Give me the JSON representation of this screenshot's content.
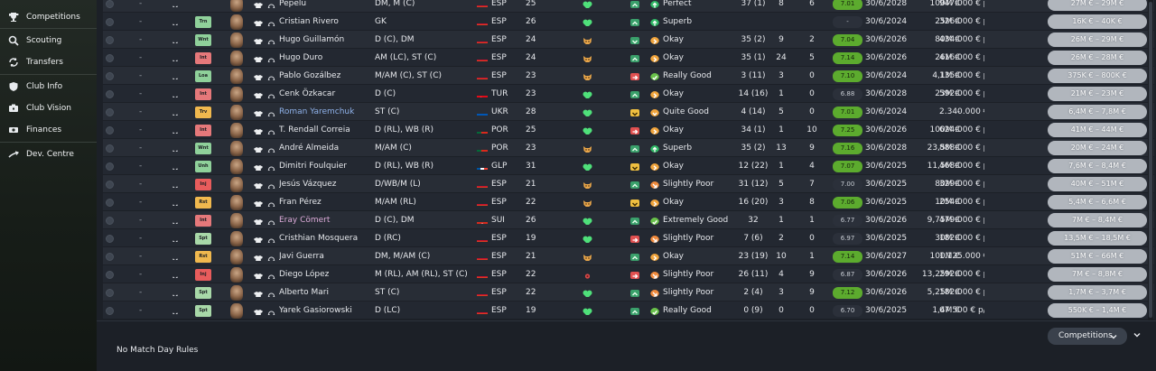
{
  "sidebar": {
    "items": [
      {
        "label": "Competitions",
        "icon": "trophy-icon"
      },
      {
        "label": "Scouting",
        "icon": "search-icon"
      },
      {
        "label": "Transfers",
        "icon": "transfer-arrows-icon"
      },
      {
        "label": "Club Info",
        "icon": "shield-icon"
      },
      {
        "label": "Club Vision",
        "icon": "club-vision-icon"
      },
      {
        "label": "Finances",
        "icon": "finances-icon"
      },
      {
        "label": "Dev. Centre",
        "icon": "development-icon"
      }
    ]
  },
  "colors": {
    "rating_green": "#5cab2e",
    "heart_green": "#4fe07a",
    "status_green": "#2fb765",
    "status_orange": "#f0a43c",
    "morale_green": "#3aa06b",
    "morale_red": "#e05050",
    "morale_yellow": "#f0c040"
  },
  "players": [
    {
      "name": "Pepelu",
      "role": "",
      "pos": "DM, M (C)",
      "flag": "ESP",
      "nat": "ESP",
      "age": "25",
      "heart": "green",
      "morale": "up",
      "status": "Perfect",
      "status_icon": "up",
      "apps": "37 (1)",
      "gls": "8",
      "ast": "6",
      "rating": "7.01",
      "rating_good": true,
      "expires": "30/6/2028",
      "value": "100M €",
      "wage": "947.000 € p/a",
      "range": "27M € – 29M €",
      "name_style": ""
    },
    {
      "name": "Cristian Rivero",
      "role": "Trn",
      "pos": "GK",
      "flag": "ESP",
      "nat": "ESP",
      "age": "26",
      "heart": "green",
      "morale": "up",
      "status": "Superb",
      "status_icon": "up",
      "apps": "",
      "gls": "",
      "ast": "",
      "rating": "-",
      "rating_good": false,
      "expires": "30/6/2024",
      "value": "25M €",
      "wage": "326.000 € p/a",
      "range": "16K € – 40K €",
      "name_style": ""
    },
    {
      "name": "Hugo Guillamón",
      "role": "Wnt",
      "pos": "D (C), DM",
      "flag": "ESP",
      "nat": "ESP",
      "age": "24",
      "heart": "fox",
      "morale": "down",
      "status": "Okay",
      "status_icon": "right",
      "apps": "35 (2)",
      "gls": "9",
      "ast": "2",
      "rating": "7.04",
      "rating_good": true,
      "expires": "30/6/2026",
      "value": "80M €",
      "wage": "434.000 € p/a",
      "range": "26M € – 29M €",
      "name_style": ""
    },
    {
      "name": "Hugo Duro",
      "role": "Int",
      "pos": "AM (LC), ST (C)",
      "flag": "ESP",
      "nat": "ESP",
      "age": "24",
      "heart": "fox",
      "morale": "up",
      "status": "Okay",
      "status_icon": "right",
      "apps": "35 (1)",
      "gls": "24",
      "ast": "5",
      "rating": "7.14",
      "rating_good": true,
      "expires": "30/6/2026",
      "value": "26M €",
      "wage": "416.000 € p/a",
      "range": "26M € – 28M €",
      "name_style": ""
    },
    {
      "name": "Pablo Gozálbez",
      "role": "Loa",
      "pos": "M/AM (C), ST (C)",
      "flag": "ESP",
      "nat": "ESP",
      "age": "23",
      "heart": "fox",
      "morale": "red",
      "status": "Really Good",
      "status_icon": "check",
      "apps": "3 (11)",
      "gls": "3",
      "ast": "0",
      "rating": "7.10",
      "rating_good": true,
      "expires": "30/6/2024",
      "value": "4,1M €",
      "wage": "135.000 € p/a",
      "range": "375K € – 800K €",
      "name_style": ""
    },
    {
      "name": "Cenk Özkacar",
      "role": "Int",
      "pos": "D (C)",
      "flag": "TUR",
      "nat": "TUR",
      "age": "23",
      "heart": "green",
      "morale": "up",
      "status": "Okay",
      "status_icon": "right",
      "apps": "14 (16)",
      "gls": "1",
      "ast": "0",
      "rating": "6.88",
      "rating_good": false,
      "expires": "30/6/2028",
      "value": "23M €",
      "wage": "592.000 € p/a",
      "range": "21M € – 23M €",
      "name_style": ""
    },
    {
      "name": "Roman Yaremchuk",
      "role": "Trv",
      "pos": "ST (C)",
      "flag": "UKR",
      "nat": "UKR",
      "age": "28",
      "heart": "green",
      "morale": "yellow",
      "status": "Quite Good",
      "status_icon": "down",
      "apps": "4 (14)",
      "gls": "5",
      "ast": "0",
      "rating": "7.01",
      "rating_good": true,
      "expires": "30/6/2024",
      "value": "-",
      "wage": "2.340.000 € p/a",
      "range": "6,4M € – 7,8M €",
      "name_style": "hl"
    },
    {
      "name": "T. Rendall Correia",
      "role": "Int",
      "pos": "D (RL), WB (R)",
      "flag": "POR",
      "nat": "POR",
      "age": "25",
      "heart": "green",
      "morale": "red",
      "status": "Okay",
      "status_icon": "right",
      "apps": "34 (1)",
      "gls": "1",
      "ast": "10",
      "rating": "7.25",
      "rating_good": true,
      "expires": "30/6/2026",
      "value": "100M €",
      "wage": "624.000 € p/a",
      "range": "41M € – 44M €",
      "name_style": ""
    },
    {
      "name": "André Almeida",
      "role": "Wnt",
      "pos": "M/AM (C)",
      "flag": "POR",
      "nat": "POR",
      "age": "23",
      "heart": "fox",
      "morale": "up",
      "status": "Superb",
      "status_icon": "up",
      "apps": "35 (2)",
      "gls": "13",
      "ast": "9",
      "rating": "7.16",
      "rating_good": true,
      "expires": "30/6/2028",
      "value": "23,5M €",
      "wage": "888.000 € p/a",
      "range": "20M € – 24M €",
      "name_style": ""
    },
    {
      "name": "Dimitri Foulquier",
      "role": "Unh",
      "pos": "D (RL), WB (R)",
      "flag": "GLP",
      "nat": "GLP",
      "age": "31",
      "heart": "green",
      "morale": "yellow",
      "status": "Okay",
      "status_icon": "right",
      "apps": "12 (22)",
      "gls": "1",
      "ast": "4",
      "rating": "7.07",
      "rating_good": true,
      "expires": "30/6/2025",
      "value": "11,5M €",
      "wage": "468.000 € p/a",
      "range": "7,6M € – 8,4M €",
      "name_style": ""
    },
    {
      "name": "Jesús Vázquez",
      "role": "Inj",
      "pos": "D/WB/M (L)",
      "flag": "ESP",
      "nat": "ESP",
      "age": "21",
      "heart": "fox",
      "morale": "up",
      "status": "Slightly Poor",
      "status_icon": "downright",
      "apps": "31 (12)",
      "gls": "5",
      "ast": "7",
      "rating": "7.00",
      "rating_good": false,
      "expires": "30/6/2025",
      "value": "80M €",
      "wage": "329.000 € p/a",
      "range": "40M € – 51M €",
      "name_style": ""
    },
    {
      "name": "Fran Pérez",
      "role": "Rst",
      "pos": "M/AM (RL)",
      "flag": "ESP",
      "nat": "ESP",
      "age": "22",
      "heart": "fox",
      "morale": "yellow",
      "status": "Okay",
      "status_icon": "right",
      "apps": "16 (20)",
      "gls": "3",
      "ast": "8",
      "rating": "7.06",
      "rating_good": true,
      "expires": "30/6/2025",
      "value": "10M €",
      "wage": "254.000 € p/a",
      "range": "5,4M € – 6,6M €",
      "name_style": ""
    },
    {
      "name": "Eray Cömert",
      "role": "Int",
      "pos": "D (C), DM",
      "flag": "SUI",
      "nat": "SUI",
      "age": "26",
      "heart": "green",
      "morale": "up",
      "status": "Extremely Good",
      "status_icon": "check",
      "apps": "32",
      "gls": "1",
      "ast": "1",
      "rating": "6.77",
      "rating_good": false,
      "expires": "30/6/2026",
      "value": "9,75M €",
      "wage": "479.000 € p/a",
      "range": "7M € – 8,4M €",
      "name_style": "pink"
    },
    {
      "name": "Cristhian Mosquera",
      "role": "Spt",
      "pos": "D (RC)",
      "flag": "ESP",
      "nat": "ESP",
      "age": "19",
      "heart": "green",
      "morale": "red",
      "status": "Slightly Poor",
      "status_icon": "downright",
      "apps": "7 (6)",
      "gls": "2",
      "ast": "0",
      "rating": "6.97",
      "rating_good": false,
      "expires": "30/6/2025",
      "value": "30M €",
      "wage": "182.000 € p/a",
      "range": "13,5M € – 18,5M €",
      "name_style": ""
    },
    {
      "name": "Javi Guerra",
      "role": "Rst",
      "pos": "DM, M/AM (C)",
      "flag": "ESP",
      "nat": "ESP",
      "age": "21",
      "heart": "fox",
      "morale": "up",
      "status": "Okay",
      "status_icon": "right",
      "apps": "23 (19)",
      "gls": "10",
      "ast": "1",
      "rating": "7.14",
      "rating_good": true,
      "expires": "30/6/2027",
      "value": "100M €",
      "wage": "1.125.000 € p/a",
      "range": "51M € – 66M €",
      "name_style": ""
    },
    {
      "name": "Diego López",
      "role": "Inj",
      "pos": "M (RL), AM (RL), ST (C)",
      "flag": "ESP",
      "nat": "ESP",
      "age": "22",
      "heart": "injury",
      "morale": "red",
      "status": "Slightly Poor",
      "status_icon": "downright",
      "apps": "26 (11)",
      "gls": "4",
      "ast": "9",
      "rating": "6.87",
      "rating_good": false,
      "expires": "30/6/2026",
      "value": "13,25M €",
      "wage": "292.000 € p/a",
      "range": "7M € – 8,8M €",
      "name_style": ""
    },
    {
      "name": "Alberto Mari",
      "role": "Spt",
      "pos": "ST (C)",
      "flag": "ESP",
      "nat": "ESP",
      "age": "22",
      "heart": "green",
      "morale": "up",
      "status": "Slightly Poor",
      "status_icon": "downright",
      "apps": "2 (4)",
      "gls": "3",
      "ast": "9",
      "rating": "7.12",
      "rating_good": true,
      "expires": "30/6/2026",
      "value": "5,25M €",
      "wage": "182.000 € p/a",
      "range": "1,7M € – 3,7M €",
      "name_style": ""
    },
    {
      "name": "Yarek Gasiorowski",
      "role": "Spt",
      "pos": "D (LC)",
      "flag": "ESP",
      "nat": "ESP",
      "age": "19",
      "heart": "green",
      "morale": "up",
      "status": "Really Good",
      "status_icon": "check",
      "apps": "0 (9)",
      "gls": "0",
      "ast": "0",
      "rating": "6.70",
      "rating_good": false,
      "expires": "30/6/2025",
      "value": "1,4M €",
      "wage": "67.500 € p/a",
      "range": "550K € – 1,4M €",
      "name_style": ""
    }
  ],
  "footer": {
    "rules_text": "No Match Day Rules",
    "dropdown_label": "Competitions"
  },
  "row_dash": "-"
}
